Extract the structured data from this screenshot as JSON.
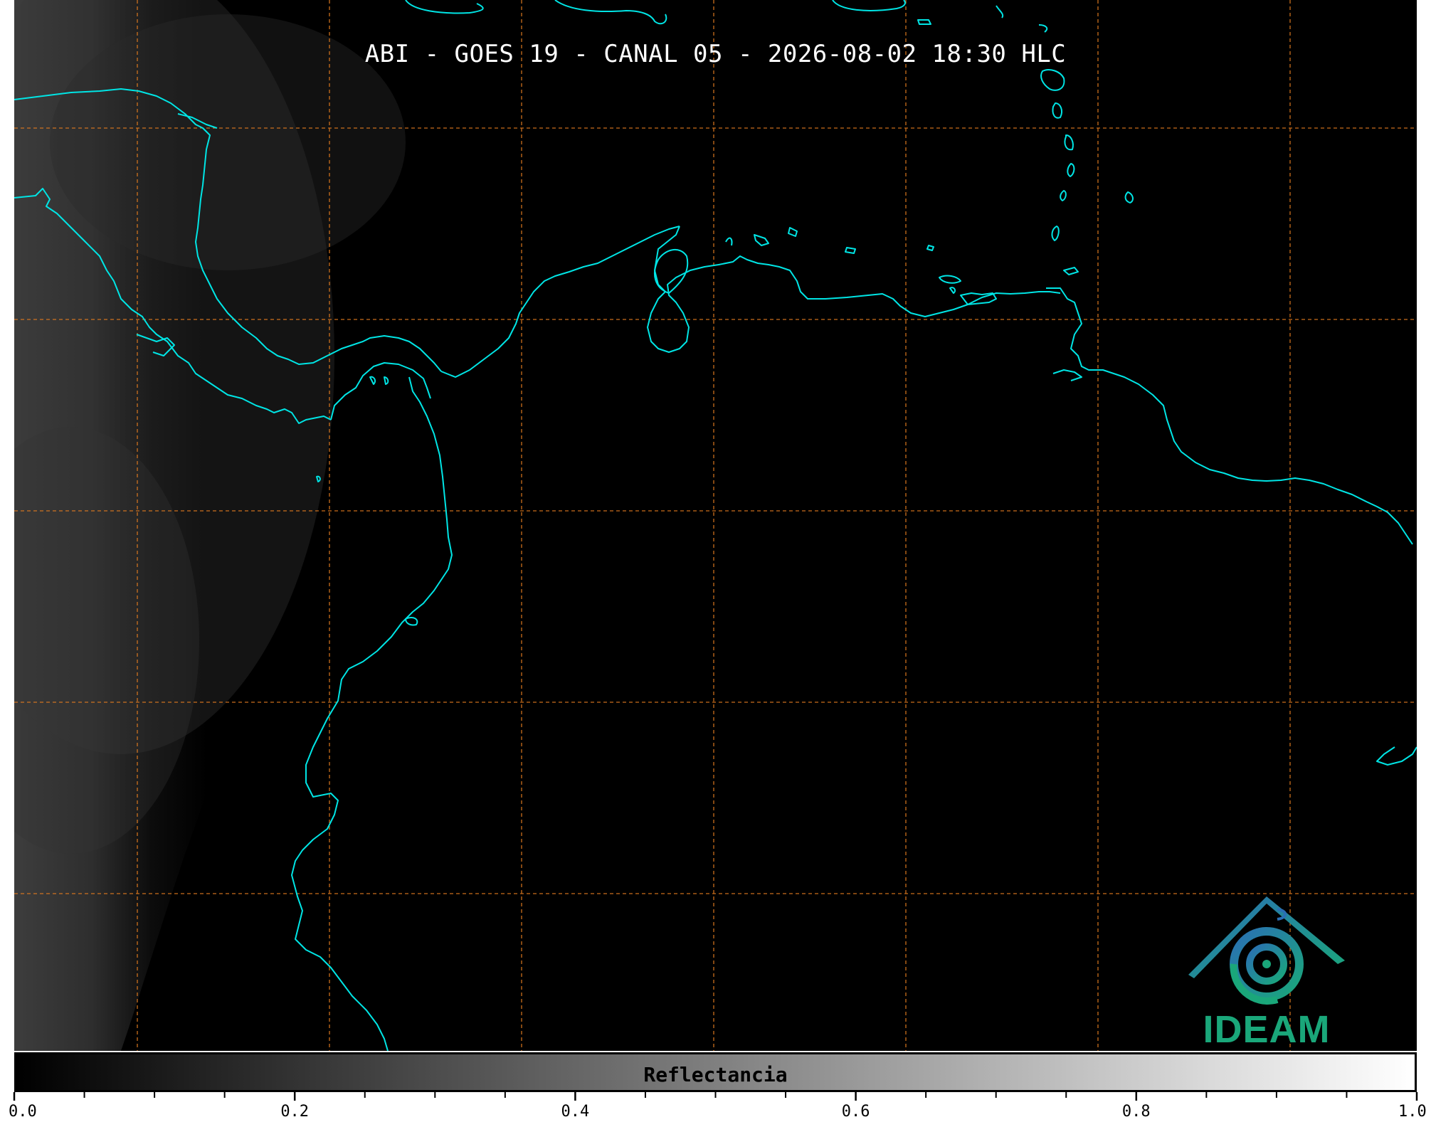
{
  "title": "ABI - GOES 19 - CANAL 05 - 2026-08-02 18:30 HLC",
  "logo": {
    "text": "IDEAM"
  },
  "colorbar": {
    "label": "Reflectancia",
    "range": [
      0.0,
      1.0
    ],
    "ticks": [
      "0.0",
      "0.2",
      "0.4",
      "0.6",
      "0.8",
      "1.0"
    ],
    "minor_step": 0.05,
    "colormap": "grayscale"
  },
  "colors": {
    "background": "#000000",
    "coastline": "#00e5e5",
    "gridlines": "#e07a1f",
    "logo_text": "#1aa77a",
    "logo_gradient": [
      "#2a6fb4",
      "#1aa77a"
    ]
  },
  "map": {
    "gridlines": "dashed",
    "features": [
      "coastlines",
      "cloud cover"
    ]
  }
}
